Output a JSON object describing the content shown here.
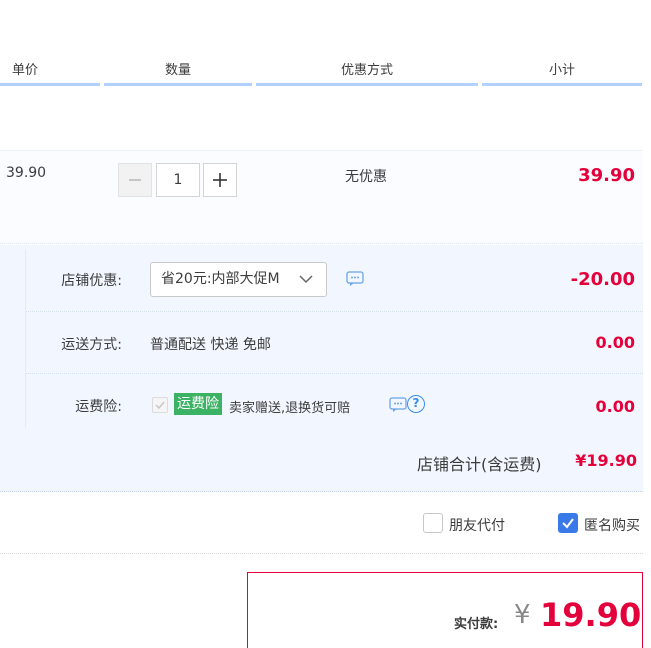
{
  "table_header": {
    "unit_price": "单价",
    "quantity": "数量",
    "discount_method": "优惠方式",
    "subtotal": "小计"
  },
  "item": {
    "unit_price": "39.90",
    "quantity": "1",
    "discount": "无优惠",
    "subtotal": "39.90"
  },
  "shop": {
    "coupon_label": "店铺优惠:",
    "coupon_selected": "省20元:内部大促M",
    "coupon_value": "-20.00",
    "shipping_label": "运送方式:",
    "shipping_text": "普通配送 快递 免邮",
    "shipping_value": "0.00",
    "insurance_label": "运费险:",
    "insurance_tag": "运费险",
    "insurance_desc": "卖家赠送,退换货可赔",
    "insurance_value": "0.00",
    "total_label": "店铺合计(含运费)",
    "total_value": "¥19.90"
  },
  "options": {
    "friend_pay": "朋友代付",
    "friend_pay_checked": false,
    "anonymous": "匿名购买",
    "anonymous_checked": true
  },
  "payment": {
    "label": "实付款:",
    "currency": "¥",
    "amount": "19.90"
  },
  "colors": {
    "price_red": "#e4003b",
    "header_underline": "#b2d1ff",
    "shop_bg": "#f2f7ff",
    "insurance_green": "#3cb364",
    "checkbox_blue": "#3a7ae8"
  }
}
